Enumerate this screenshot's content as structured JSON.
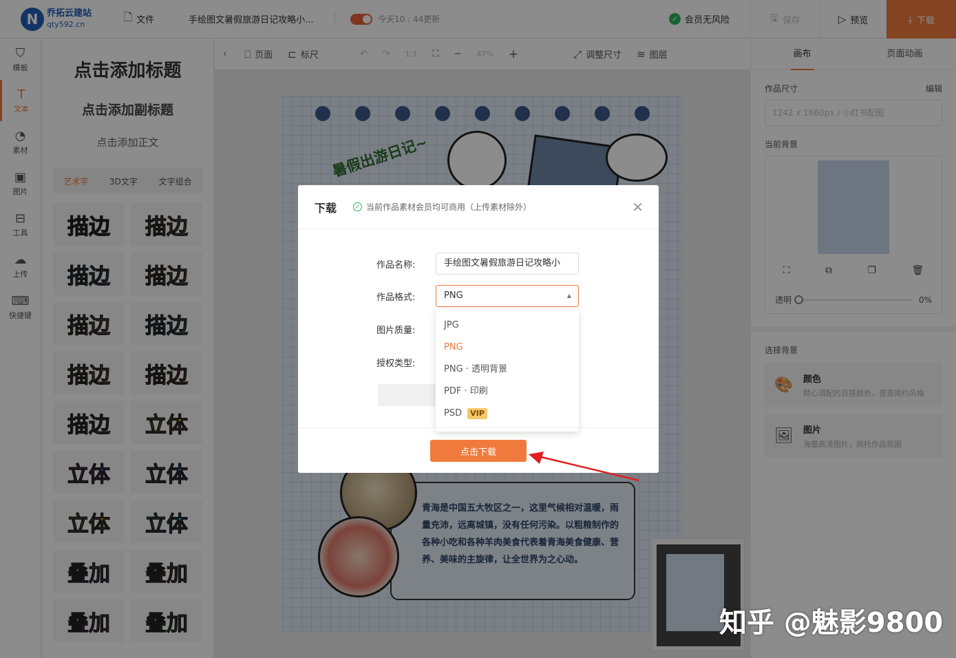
{
  "topbar": {
    "logo_badge": "N",
    "logo_name": "乔拓云建站",
    "logo_url": "qty592.cn",
    "file_menu": "文件",
    "doc_title": "手绘图文暑假旅游日记攻略小...",
    "saved_time": "今天10 : 44更新",
    "vip_safe": "会员无风险",
    "save": "保存",
    "preview": "预览",
    "download": "下载"
  },
  "rail": [
    {
      "label": "模板",
      "icon": "T-shirt-icon"
    },
    {
      "label": "文本",
      "icon": "text-icon"
    },
    {
      "label": "素材",
      "icon": "shapes-icon"
    },
    {
      "label": "图片",
      "icon": "image-icon"
    },
    {
      "label": "工具",
      "icon": "toolbox-icon"
    },
    {
      "label": "上传",
      "icon": "upload-icon"
    },
    {
      "label": "快捷键",
      "icon": "keyboard-icon"
    }
  ],
  "text_panel": {
    "add_title": "点击添加标题",
    "add_subtitle": "点击添加副标题",
    "add_body": "点击添加正文",
    "tabs": [
      "艺术字",
      "3D文字",
      "文字组合"
    ],
    "art_styles": [
      {
        "text": "描边",
        "color": "#111111"
      },
      {
        "text": "描边",
        "color": "#e8a45a"
      },
      {
        "text": "描边",
        "color": "#3a7fd8"
      },
      {
        "text": "描边",
        "color": "#e87a3a"
      },
      {
        "text": "描边",
        "color": "#d8b03a"
      },
      {
        "text": "描边",
        "color": "#3aa0d8"
      },
      {
        "text": "描边",
        "color": "#e89a1a"
      },
      {
        "text": "描边",
        "color": "#d83a3a"
      },
      {
        "text": "描边",
        "color": "#555555"
      },
      {
        "text": "立体",
        "color": "#e8b01a"
      },
      {
        "text": "立体",
        "color": "#8a3ad8"
      },
      {
        "text": "立体",
        "color": "#3a8ad8"
      },
      {
        "text": "立体",
        "color": "#e8901a"
      },
      {
        "text": "立体",
        "color": "#3ab0e8"
      },
      {
        "text": "叠加",
        "color": "#6a7ab8"
      },
      {
        "text": "叠加",
        "color": "#e8601a"
      },
      {
        "text": "叠加",
        "color": "#b83ad8"
      },
      {
        "text": "叠加",
        "color": "#3a9a3a"
      }
    ]
  },
  "canvas_toolbar": {
    "page": "页面",
    "ruler": "标尺",
    "ratio": "1:1",
    "zoom": "47%",
    "resize": "调整尺寸",
    "layers": "图层"
  },
  "poster": {
    "title": "暑假出游日记~",
    "body": "青海是中国五大牧区之一，这里气候相对温暖，雨量充沛，远离城镇，没有任何污染。以粗粮制作的各种小吃和各种羊肉美食代表着青海美食健康、营养、美味的主旋律，让全世界为之心动。"
  },
  "watermark": "知乎 @魅影9800",
  "right_panel": {
    "tabs": [
      "画布",
      "页面动画"
    ],
    "size_label": "作品尺寸",
    "edit": "编辑",
    "size_value": "1242 x 1660px  / 小红书配图",
    "current_bg": "当前背景",
    "opacity_label": "透明",
    "opacity_value": "0%",
    "choose_bg": "选择背景",
    "options": [
      {
        "title": "颜色",
        "desc": "精心调配的百搭颜色，营造简约风格",
        "icon": "palette-icon"
      },
      {
        "title": "图片",
        "desc": "海量高清图片，烘托作品氛围",
        "icon": "picture-icon"
      }
    ]
  },
  "modal": {
    "title": "下载",
    "note": "当前作品素材会员均可商用（上传素材除外）",
    "name_label": "作品名称:",
    "name_value": "手绘图文暑假旅游日记攻略小",
    "format_label": "作品格式:",
    "format_value": "PNG",
    "quality_label": "图片质量:",
    "license_label": "授权类型:",
    "format_options": [
      {
        "label": "JPG",
        "selected": false,
        "vip": ""
      },
      {
        "label": "PNG",
        "selected": true,
        "vip": ""
      },
      {
        "label": "PNG · 透明背景",
        "selected": false,
        "vip": ""
      },
      {
        "label": "PDF · 印刷",
        "selected": false,
        "vip": ""
      },
      {
        "label": "PSD",
        "selected": false,
        "vip": "VIP"
      }
    ],
    "confirm": "点击下载"
  },
  "colors": {
    "accent": "#f07a3c",
    "success": "#2db35b",
    "brand": "#1f5fb8"
  }
}
